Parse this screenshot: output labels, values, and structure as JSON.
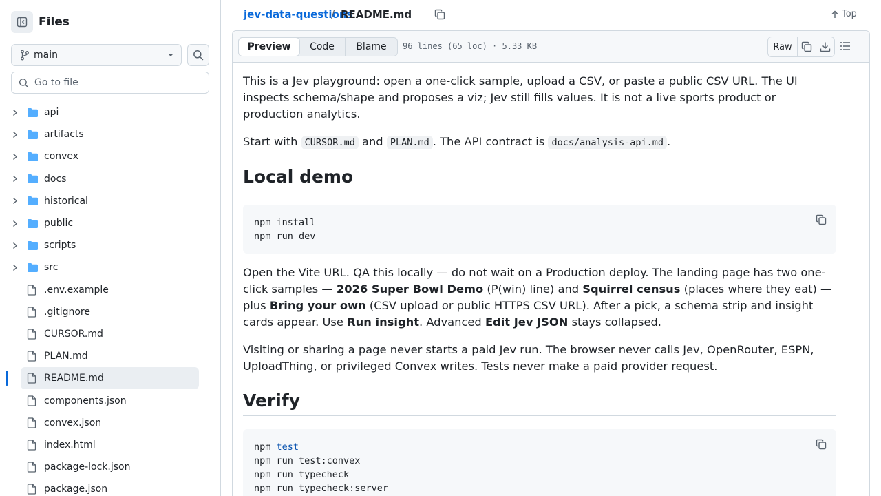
{
  "sidebar": {
    "title": "Files",
    "branch": "main",
    "goto_placeholder": "Go to file",
    "items": [
      {
        "name": "api",
        "type": "folder"
      },
      {
        "name": "artifacts",
        "type": "folder"
      },
      {
        "name": "convex",
        "type": "folder"
      },
      {
        "name": "docs",
        "type": "folder"
      },
      {
        "name": "historical",
        "type": "folder"
      },
      {
        "name": "public",
        "type": "folder"
      },
      {
        "name": "scripts",
        "type": "folder"
      },
      {
        "name": "src",
        "type": "folder"
      },
      {
        "name": ".env.example",
        "type": "file"
      },
      {
        "name": ".gitignore",
        "type": "file"
      },
      {
        "name": "CURSOR.md",
        "type": "file"
      },
      {
        "name": "PLAN.md",
        "type": "file"
      },
      {
        "name": "README.md",
        "type": "file",
        "selected": true
      },
      {
        "name": "components.json",
        "type": "file"
      },
      {
        "name": "convex.json",
        "type": "file"
      },
      {
        "name": "index.html",
        "type": "file"
      },
      {
        "name": "package-lock.json",
        "type": "file"
      },
      {
        "name": "package.json",
        "type": "file"
      }
    ]
  },
  "breadcrumb": {
    "repo": "jev-data-questions",
    "separator": "/",
    "file": "README.md",
    "top_label": "Top"
  },
  "toolbar": {
    "tabs": [
      "Preview",
      "Code",
      "Blame"
    ],
    "active_tab": "Preview",
    "file_info": "96 lines (65 loc) · 5.33 KB",
    "raw_label": "Raw"
  },
  "readme": {
    "p1": "This is a Jev playground: open a one-click sample, upload a CSV, or paste a public CSV URL. The UI inspects schema/shape and proposes a viz; Jev still fills values. It is not a live sports product or production analytics.",
    "p2_a": "Start with ",
    "p2_code1": "CURSOR.md",
    "p2_b": " and ",
    "p2_code2": "PLAN.md",
    "p2_c": ". The API contract is ",
    "p2_code3": "docs/analysis-api.md",
    "p2_d": ".",
    "h_local": "Local demo",
    "code1": [
      "npm install",
      "npm run dev"
    ],
    "p3_a": "Open the Vite URL. QA this locally — do not wait on a Production deploy. The landing page has two one-click samples — ",
    "p3_b1": "2026 Super Bowl Demo",
    "p3_c": " (P(win) line) and ",
    "p3_b2": "Squirrel census",
    "p3_d": " (places where they eat) — plus ",
    "p3_b3": "Bring your own",
    "p3_e": " (CSV upload or public HTTPS CSV URL). After a pick, a schema strip and insight cards appear. Use ",
    "p3_b4": "Run insight",
    "p3_f": ". Advanced ",
    "p3_b5": "Edit Jev JSON",
    "p3_g": " stays collapsed.",
    "p4": "Visiting or sharing a page never starts a paid Jev run. The browser never calls Jev, OpenRouter, ESPN, UploadThing, or privileged Convex writes. Tests never make a paid provider request.",
    "h_verify": "Verify",
    "code2_first_cmd": "npm",
    "code2_first_arg": "test",
    "code2": [
      "npm run test:convex",
      "npm run typecheck",
      "npm run typecheck:server"
    ]
  },
  "colors": {
    "accent": "#0969da",
    "border": "#d1d9e0",
    "muted": "#59636e",
    "folder": "#54aeff",
    "selected_bg": "#eaeef2"
  }
}
